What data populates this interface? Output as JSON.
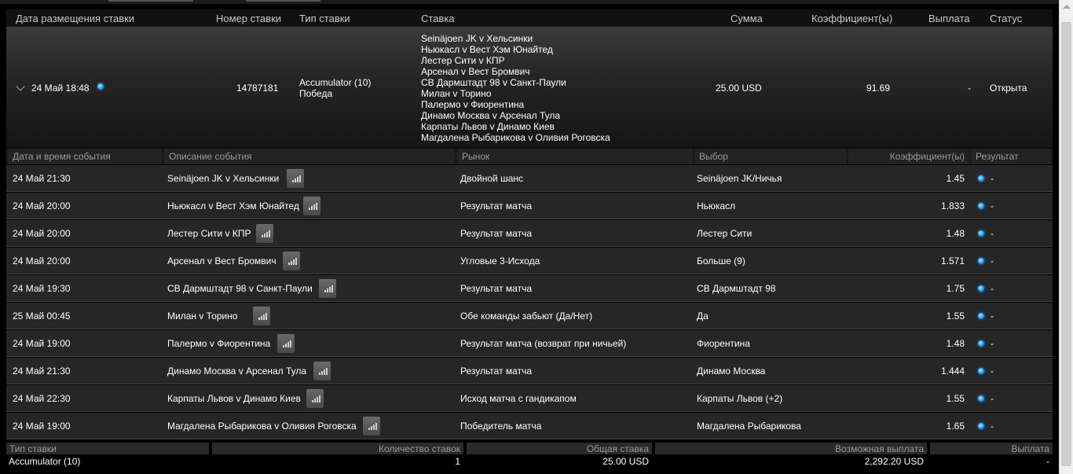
{
  "main_header": {
    "date": "Дата размещения ставки",
    "number": "Номер ставки",
    "type": "Тип ставки",
    "bet": "Ставка",
    "amount": "Сумма",
    "odds": "Коэффициент(ы)",
    "payout": "Выплата",
    "status": "Статус"
  },
  "bet": {
    "date": "24 Май 18:48",
    "number": "14787181",
    "type_line1": "Accumulator (10)",
    "type_line2": "Победа",
    "matches": [
      "Seinäjoen JK v Хельсинки",
      "Ньюкасл v Вест Хэм Юнайтед",
      "Лестер Сити v КПР",
      "Арсенал v Вест Бромвич",
      "СВ Дармштадт 98 v Санкт-Паули",
      "Милан v Торино",
      "Палермо v Фиорентина",
      "Динамо Москва v Арсенал Тула",
      "Карпаты Львов v Динамо Киев",
      "Магдалена Рыбарикова v Оливия Роговска"
    ],
    "amount": "25.00 USD",
    "odds": "91.69",
    "payout": "-",
    "status": "Открыта"
  },
  "sub_header": {
    "datetime": "Дата и время события",
    "description": "Описание события",
    "market": "Рынок",
    "selection": "Выбор",
    "odds": "Коэффициент(ы)",
    "result": "Результат"
  },
  "events": [
    {
      "datetime": "24 Май 21:30",
      "description": "Seinäjoen JK v Хельсинки",
      "market": "Двойной шанс",
      "selection": "Seinäjoen JK/Ничья",
      "odds": "1.45",
      "result": "-"
    },
    {
      "datetime": "24 Май 20:00",
      "description": "Ньюкасл v Вест Хэм Юнайтед",
      "market": "Результат матча",
      "selection": "Ньюкасл",
      "odds": "1.833",
      "result": "-"
    },
    {
      "datetime": "24 Май 20:00",
      "description": "Лестер Сити v КПР",
      "market": "Результат матча",
      "selection": "Лестер Сити",
      "odds": "1.48",
      "result": "-"
    },
    {
      "datetime": "24 Май 20:00",
      "description": "Арсенал v Вест Бромвич",
      "market": "Угловые 3-Исхода",
      "selection": "Больше (9)",
      "odds": "1.571",
      "result": "-"
    },
    {
      "datetime": "24 Май 19:30",
      "description": "СВ Дармштадт 98 v Санкт-Паули",
      "market": "Результат матча",
      "selection": "СВ Дармштадт 98",
      "odds": "1.75",
      "result": "-"
    },
    {
      "datetime": "25 Май 00:45",
      "description": "Милан v Торино",
      "market": "Обе команды забьют (Да/Нет)",
      "selection": "Да",
      "odds": "1.55",
      "result": "-"
    },
    {
      "datetime": "24 Май 19:00",
      "description": "Палермо v Фиорентина",
      "market": "Результат матча (возврат при ничьей)",
      "selection": "Фиорентина",
      "odds": "1.48",
      "result": "-"
    },
    {
      "datetime": "24 Май 21:30",
      "description": "Динамо Москва v Арсенал Тула",
      "market": "Результат матча",
      "selection": "Динамо Москва",
      "odds": "1.444",
      "result": "-"
    },
    {
      "datetime": "24 Май 22:30",
      "description": "Карпаты Львов v Динамо Киев",
      "market": "Исход матча с гандикапом",
      "selection": "Карпаты Львов (+2)",
      "odds": "1.55",
      "result": "-"
    },
    {
      "datetime": "24 Май 19:00",
      "description": "Магдалена Рыбарикова v Оливия Роговска",
      "market": "Победитель матча",
      "selection": "Магдалена Рыбарикова",
      "odds": "1.65",
      "result": "-"
    }
  ],
  "footer": {
    "headers": {
      "type": "Тип ставки",
      "count": "Количество ставок",
      "total": "Общая ставка",
      "possible": "Возможная выплата",
      "payout": "Выплата"
    },
    "values": {
      "type": "Accumulator (10)",
      "count": "1",
      "total": "25.00 USD",
      "possible": "2,292.20 USD",
      "payout": "-"
    }
  },
  "icons": {
    "stats": "bar-chart-icon",
    "status_dot": "status-dot-icon",
    "expand": "chevron-down-icon"
  },
  "colors": {
    "status_dot": "#2aa6ff",
    "background": "#000000"
  }
}
